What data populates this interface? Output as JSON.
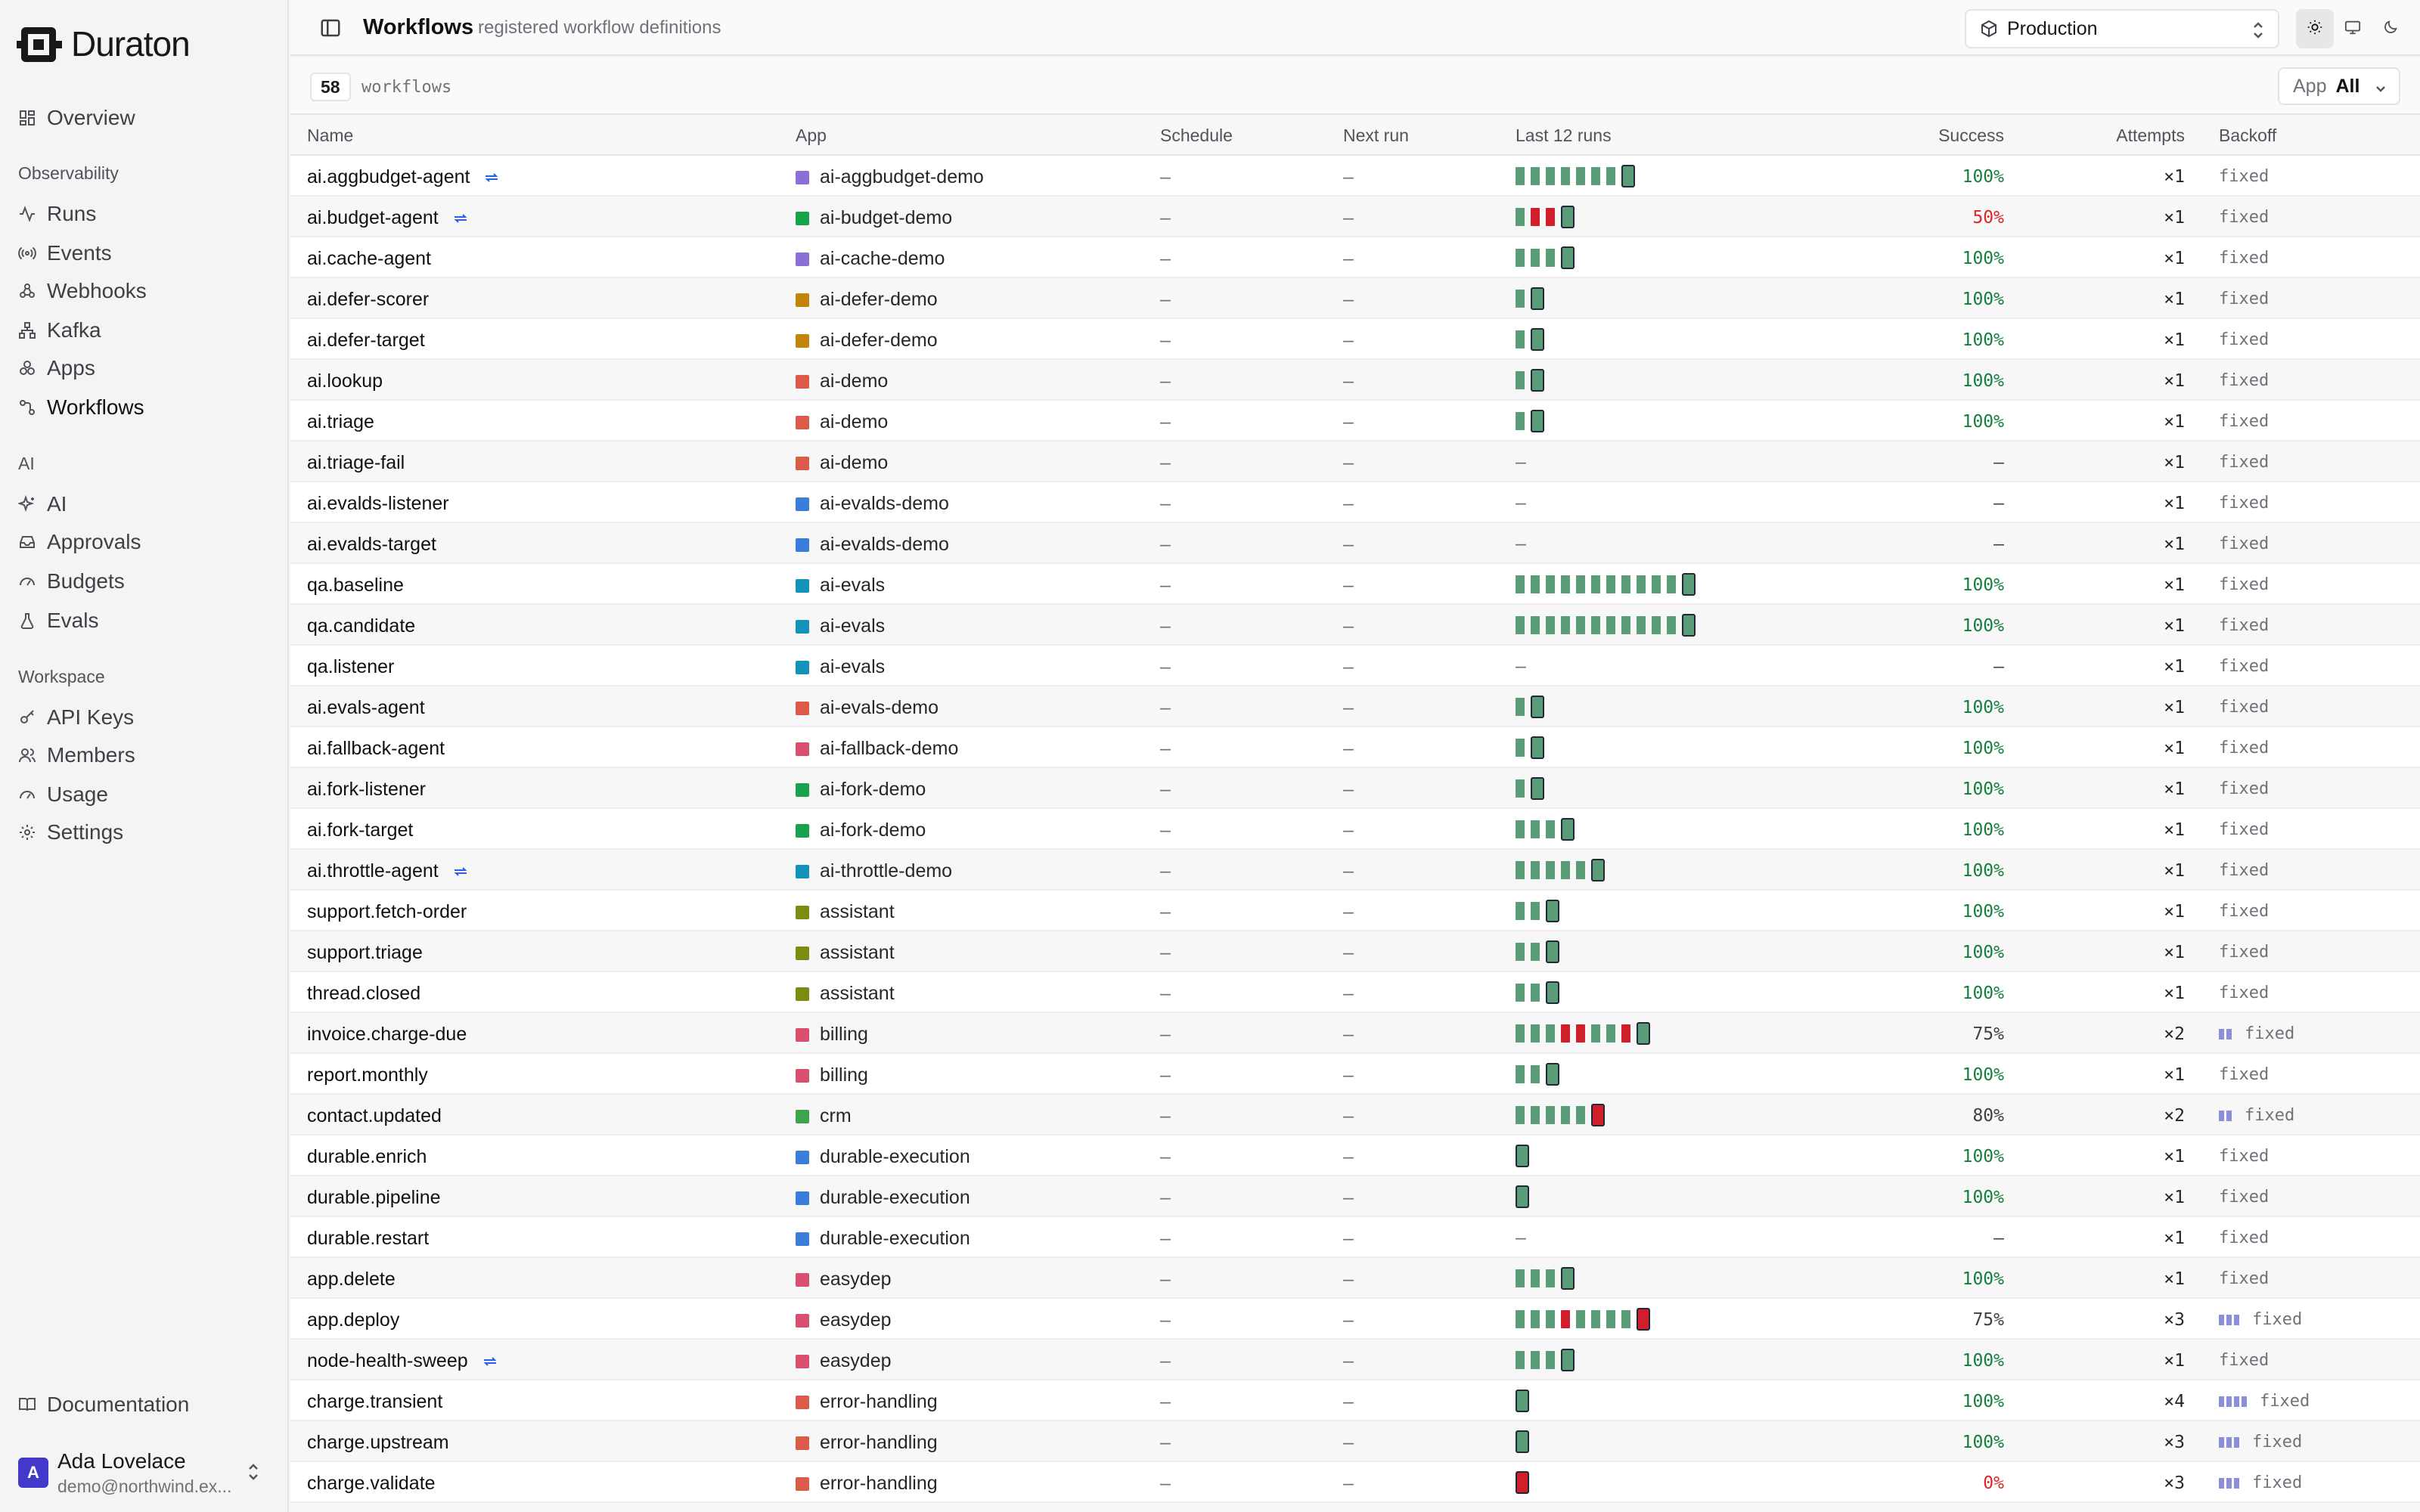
{
  "brand": {
    "name": "Duraton"
  },
  "sidebar": {
    "overview": "Overview",
    "sections": [
      {
        "label": "Observability",
        "items": [
          {
            "label": "Runs",
            "icon": "activity-icon"
          },
          {
            "label": "Events",
            "icon": "broadcast-icon"
          },
          {
            "label": "Webhooks",
            "icon": "webhook-icon"
          },
          {
            "label": "Kafka",
            "icon": "kafka-icon"
          },
          {
            "label": "Apps",
            "icon": "apps-icon"
          },
          {
            "label": "Workflows",
            "icon": "workflow-icon",
            "active": true
          }
        ]
      },
      {
        "label": "AI",
        "items": [
          {
            "label": "AI",
            "icon": "sparkles-icon"
          },
          {
            "label": "Approvals",
            "icon": "inbox-icon"
          },
          {
            "label": "Budgets",
            "icon": "gauge-icon"
          },
          {
            "label": "Evals",
            "icon": "flask-icon"
          }
        ]
      },
      {
        "label": "Workspace",
        "items": [
          {
            "label": "API Keys",
            "icon": "key-icon"
          },
          {
            "label": "Members",
            "icon": "users-icon"
          },
          {
            "label": "Usage",
            "icon": "gauge-icon"
          },
          {
            "label": "Settings",
            "icon": "gear-icon"
          }
        ]
      }
    ],
    "documentation": "Documentation",
    "user": {
      "initial": "A",
      "name": "Ada Lovelace",
      "email": "demo@northwind.ex..."
    }
  },
  "header": {
    "title": "Workflows",
    "subtitle": "registered workflow definitions",
    "environment": "Production",
    "theme_modes": [
      "light-icon",
      "monitor-icon",
      "moon-icon"
    ]
  },
  "toolbar": {
    "count": "58",
    "count_label": "workflows",
    "app_filter_label": "App",
    "app_filter_value": "All"
  },
  "table": {
    "columns": {
      "name": "Name",
      "app": "App",
      "schedule": "Schedule",
      "next_run": "Next run",
      "last_runs": "Last 12 runs",
      "success": "Success",
      "attempts": "Attempts",
      "backoff": "Backoff"
    },
    "rows": [
      {
        "name": "ai.aggbudget-agent",
        "loop": true,
        "app": "ai-aggbudget-demo",
        "color": "#8b6fd6",
        "schedule": "–",
        "next": "–",
        "runs": "oooooooo",
        "success": "100%",
        "attempts": "×1",
        "backoff": "fixed",
        "bars": 0
      },
      {
        "name": "ai.budget-agent",
        "loop": true,
        "app": "ai-budget-demo",
        "color": "#16a34a",
        "schedule": "–",
        "next": "–",
        "runs": "offo",
        "success": "50%",
        "attempts": "×1",
        "backoff": "fixed",
        "bars": 0
      },
      {
        "name": "ai.cache-agent",
        "app": "ai-cache-demo",
        "color": "#8b6fd6",
        "schedule": "–",
        "next": "–",
        "runs": "oooo",
        "success": "100%",
        "attempts": "×1",
        "backoff": "fixed",
        "bars": 0
      },
      {
        "name": "ai.defer-scorer",
        "app": "ai-defer-demo",
        "color": "#c2850c",
        "schedule": "–",
        "next": "–",
        "runs": "oo",
        "success": "100%",
        "attempts": "×1",
        "backoff": "fixed",
        "bars": 0
      },
      {
        "name": "ai.defer-target",
        "app": "ai-defer-demo",
        "color": "#c2850c",
        "schedule": "–",
        "next": "–",
        "runs": "oo",
        "success": "100%",
        "attempts": "×1",
        "backoff": "fixed",
        "bars": 0
      },
      {
        "name": "ai.lookup",
        "app": "ai-demo",
        "color": "#dc5a4a",
        "schedule": "–",
        "next": "–",
        "runs": "oo",
        "success": "100%",
        "attempts": "×1",
        "backoff": "fixed",
        "bars": 0
      },
      {
        "name": "ai.triage",
        "app": "ai-demo",
        "color": "#dc5a4a",
        "schedule": "–",
        "next": "–",
        "runs": "oo",
        "success": "100%",
        "attempts": "×1",
        "backoff": "fixed",
        "bars": 0
      },
      {
        "name": "ai.triage-fail",
        "app": "ai-demo",
        "color": "#dc5a4a",
        "schedule": "–",
        "next": "–",
        "runs": "",
        "success": "–",
        "attempts": "×1",
        "backoff": "fixed",
        "bars": 0
      },
      {
        "name": "ai.evalds-listener",
        "app": "ai-evalds-demo",
        "color": "#3b7dd8",
        "schedule": "–",
        "next": "–",
        "runs": "",
        "success": "–",
        "attempts": "×1",
        "backoff": "fixed",
        "bars": 0
      },
      {
        "name": "ai.evalds-target",
        "app": "ai-evalds-demo",
        "color": "#3b7dd8",
        "schedule": "–",
        "next": "–",
        "runs": "",
        "success": "–",
        "attempts": "×1",
        "backoff": "fixed",
        "bars": 0
      },
      {
        "name": "qa.baseline",
        "app": "ai-evals",
        "color": "#1493b8",
        "schedule": "–",
        "next": "–",
        "runs": "oooooooooooo",
        "success": "100%",
        "attempts": "×1",
        "backoff": "fixed",
        "bars": 0
      },
      {
        "name": "qa.candidate",
        "app": "ai-evals",
        "color": "#1493b8",
        "schedule": "–",
        "next": "–",
        "runs": "oooooooooooo",
        "success": "100%",
        "attempts": "×1",
        "backoff": "fixed",
        "bars": 0
      },
      {
        "name": "qa.listener",
        "app": "ai-evals",
        "color": "#1493b8",
        "schedule": "–",
        "next": "–",
        "runs": "",
        "success": "–",
        "attempts": "×1",
        "backoff": "fixed",
        "bars": 0
      },
      {
        "name": "ai.evals-agent",
        "app": "ai-evals-demo",
        "color": "#dc5a4a",
        "schedule": "–",
        "next": "–",
        "runs": "oo",
        "success": "100%",
        "attempts": "×1",
        "backoff": "fixed",
        "bars": 0
      },
      {
        "name": "ai.fallback-agent",
        "app": "ai-fallback-demo",
        "color": "#d9506e",
        "schedule": "–",
        "next": "–",
        "runs": "oo",
        "success": "100%",
        "attempts": "×1",
        "backoff": "fixed",
        "bars": 0
      },
      {
        "name": "ai.fork-listener",
        "app": "ai-fork-demo",
        "color": "#16a34a",
        "schedule": "–",
        "next": "–",
        "runs": "oo",
        "success": "100%",
        "attempts": "×1",
        "backoff": "fixed",
        "bars": 0
      },
      {
        "name": "ai.fork-target",
        "app": "ai-fork-demo",
        "color": "#16a34a",
        "schedule": "–",
        "next": "–",
        "runs": "oooo",
        "success": "100%",
        "attempts": "×1",
        "backoff": "fixed",
        "bars": 0
      },
      {
        "name": "ai.throttle-agent",
        "loop": true,
        "app": "ai-throttle-demo",
        "color": "#1493b8",
        "schedule": "–",
        "next": "–",
        "runs": "oooooo",
        "success": "100%",
        "attempts": "×1",
        "backoff": "fixed",
        "bars": 0
      },
      {
        "name": "support.fetch-order",
        "app": "assistant",
        "color": "#7c8c12",
        "schedule": "–",
        "next": "–",
        "runs": "ooo",
        "success": "100%",
        "attempts": "×1",
        "backoff": "fixed",
        "bars": 0
      },
      {
        "name": "support.triage",
        "app": "assistant",
        "color": "#7c8c12",
        "schedule": "–",
        "next": "–",
        "runs": "ooo",
        "success": "100%",
        "attempts": "×1",
        "backoff": "fixed",
        "bars": 0
      },
      {
        "name": "thread.closed",
        "app": "assistant",
        "color": "#7c8c12",
        "schedule": "–",
        "next": "–",
        "runs": "ooo",
        "success": "100%",
        "attempts": "×1",
        "backoff": "fixed",
        "bars": 0
      },
      {
        "name": "invoice.charge-due",
        "app": "billing",
        "color": "#d9506e",
        "schedule": "–",
        "next": "–",
        "runs": "oooffoofo",
        "success": "75%",
        "attempts": "×2",
        "backoff": "fixed",
        "bars": 2
      },
      {
        "name": "report.monthly",
        "app": "billing",
        "color": "#d9506e",
        "schedule": "–",
        "next": "–",
        "runs": "ooo",
        "success": "100%",
        "attempts": "×1",
        "backoff": "fixed",
        "bars": 0
      },
      {
        "name": "contact.updated",
        "app": "crm",
        "color": "#3fa34d",
        "schedule": "–",
        "next": "–",
        "runs": "ooooof",
        "success": "80%",
        "attempts": "×2",
        "backoff": "fixed",
        "bars": 2
      },
      {
        "name": "durable.enrich",
        "app": "durable-execution",
        "color": "#3b7dd8",
        "schedule": "–",
        "next": "–",
        "runs": "o",
        "success": "100%",
        "attempts": "×1",
        "backoff": "fixed",
        "bars": 0
      },
      {
        "name": "durable.pipeline",
        "app": "durable-execution",
        "color": "#3b7dd8",
        "schedule": "–",
        "next": "–",
        "runs": "o",
        "success": "100%",
        "attempts": "×1",
        "backoff": "fixed",
        "bars": 0
      },
      {
        "name": "durable.restart",
        "app": "durable-execution",
        "color": "#3b7dd8",
        "schedule": "–",
        "next": "–",
        "runs": "",
        "success": "–",
        "attempts": "×1",
        "backoff": "fixed",
        "bars": 0
      },
      {
        "name": "app.delete",
        "app": "easydep",
        "color": "#d9506e",
        "schedule": "–",
        "next": "–",
        "runs": "oooo",
        "success": "100%",
        "attempts": "×1",
        "backoff": "fixed",
        "bars": 0
      },
      {
        "name": "app.deploy",
        "app": "easydep",
        "color": "#d9506e",
        "schedule": "–",
        "next": "–",
        "runs": "ooofoooof",
        "success": "75%",
        "attempts": "×3",
        "backoff": "fixed",
        "bars": 3
      },
      {
        "name": "node-health-sweep",
        "loop": true,
        "app": "easydep",
        "color": "#d9506e",
        "schedule": "–",
        "next": "–",
        "runs": "oooo",
        "success": "100%",
        "attempts": "×1",
        "backoff": "fixed",
        "bars": 0
      },
      {
        "name": "charge.transient",
        "app": "error-handling",
        "color": "#dc5a4a",
        "schedule": "–",
        "next": "–",
        "runs": "o",
        "success": "100%",
        "attempts": "×4",
        "backoff": "fixed",
        "bars": 4
      },
      {
        "name": "charge.upstream",
        "app": "error-handling",
        "color": "#dc5a4a",
        "schedule": "–",
        "next": "–",
        "runs": "o",
        "success": "100%",
        "attempts": "×3",
        "backoff": "fixed",
        "bars": 3
      },
      {
        "name": "charge.validate",
        "app": "error-handling",
        "color": "#dc5a4a",
        "schedule": "–",
        "next": "–",
        "runs": "f",
        "success": "0%",
        "attempts": "×3",
        "backoff": "fixed",
        "bars": 3
      }
    ]
  }
}
